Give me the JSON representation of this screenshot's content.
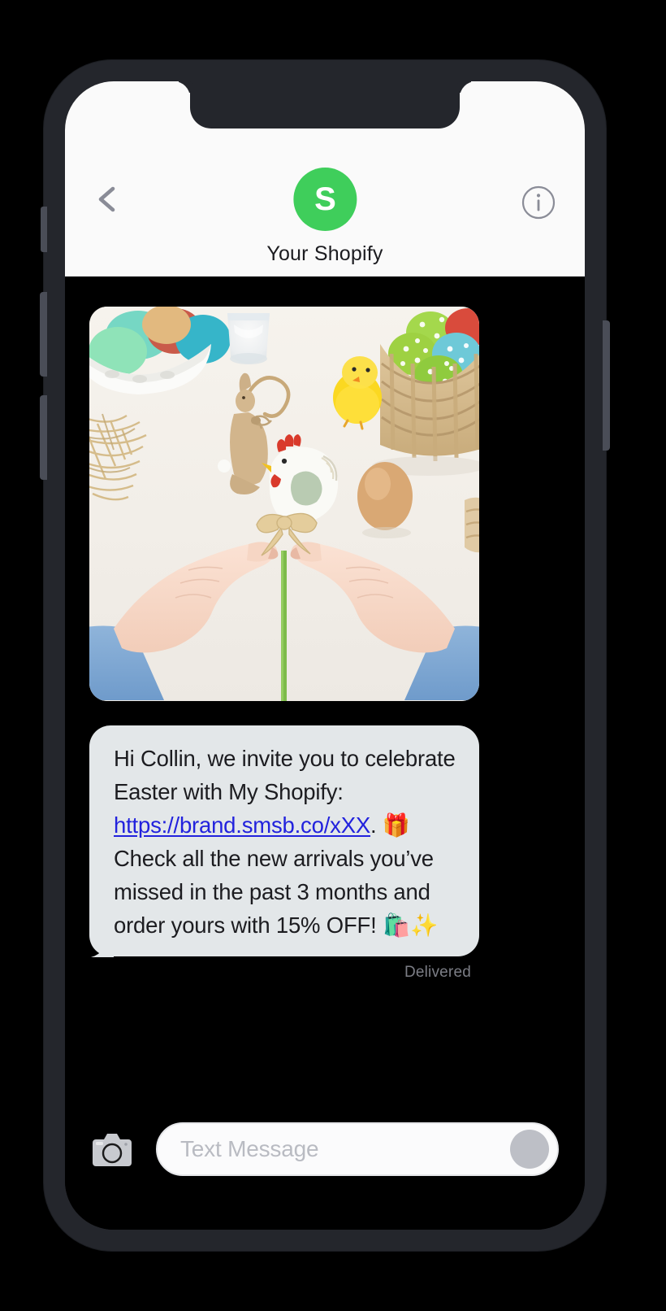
{
  "device": {
    "type": "smartphone",
    "frame_color": "#24262C",
    "buttons": [
      "silent-switch",
      "volume-up",
      "volume-down",
      "power"
    ]
  },
  "header": {
    "back_icon": "chevron-left-icon",
    "info_icon": "info-circle-icon",
    "avatar_initial": "S",
    "avatar_color": "#3FCE5B",
    "contact_name": "Your Shopify"
  },
  "conversation": {
    "attachment": {
      "icon": "image-attachment",
      "alt": "Easter flat-lay photo: hands tying a raffia bow on a wooden chicken decoration, bowl of colored eggs, glass, straw nest, wooden bunny ornament, yellow chick, basket of polka-dot eggs and a brown egg"
    },
    "message": {
      "greeting": "Hi Collin, we invite you to celebrate Easter with My Shopify: ",
      "link_text": "https://brand.smsb.co/xXX",
      "after_link": ". ",
      "emoji_gift": "🎁",
      "body": " Check all the new arrivals you’ve missed in the past 3 months and order yours with 15% OFF! ",
      "emoji_bags": "🛍️",
      "emoji_sparkles": "✨",
      "bubble_color": "#E3E7E9",
      "link_color": "#2222DD"
    },
    "status": "Delivered"
  },
  "input_bar": {
    "camera_icon": "camera-icon",
    "placeholder": "Text Message",
    "send_icon": "send-button-circle"
  }
}
